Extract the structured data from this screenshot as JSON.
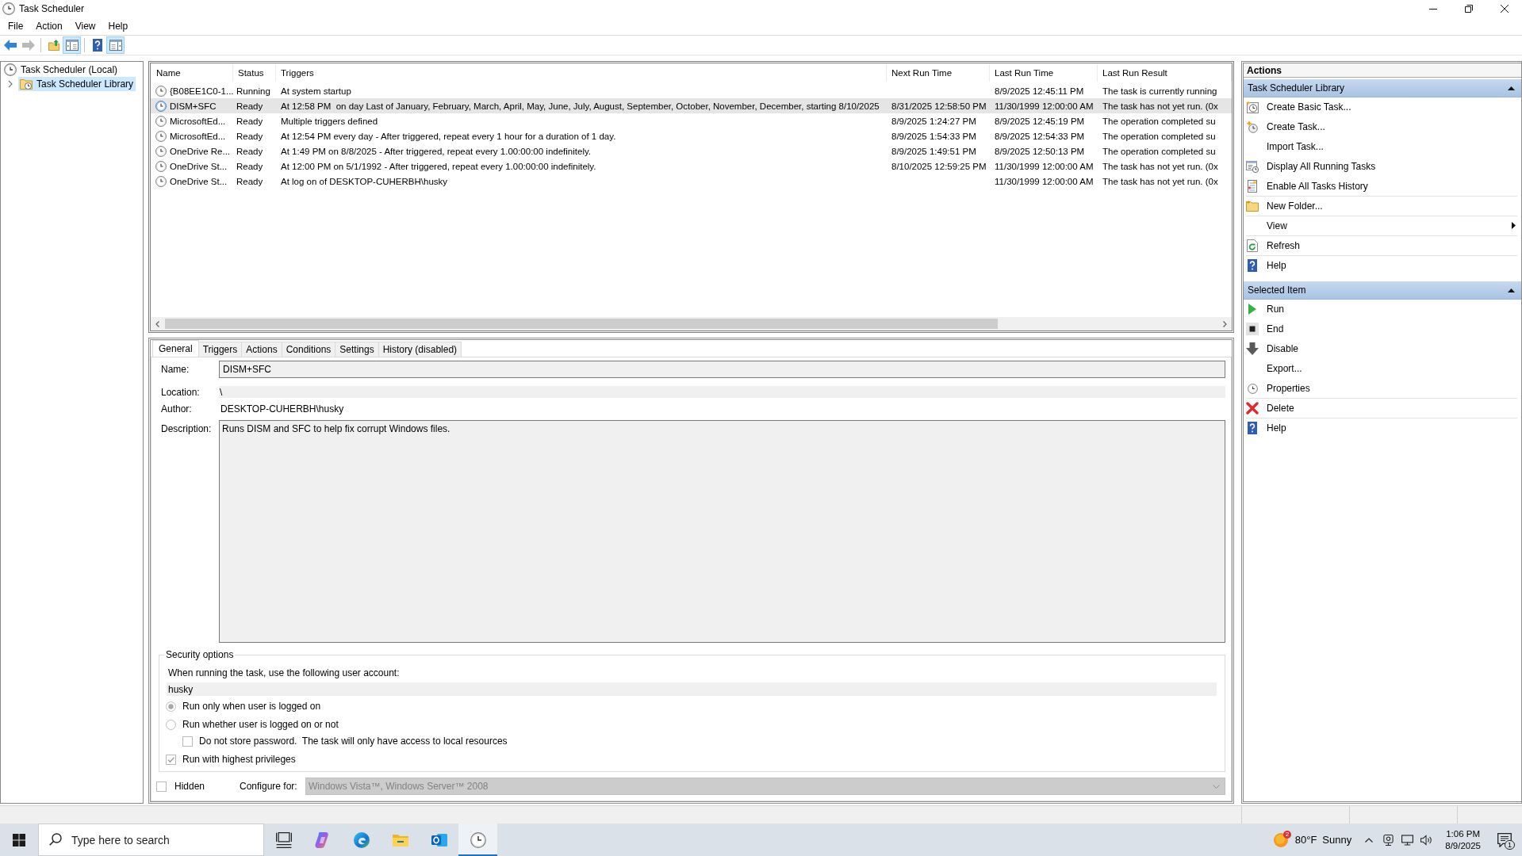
{
  "window": {
    "title": "Task Scheduler"
  },
  "menu_bar": [
    "File",
    "Action",
    "View",
    "Help"
  ],
  "toolbar": [
    [
      {
        "kind": "back",
        "disabled": false,
        "pressed": false
      },
      {
        "kind": "forward",
        "disabled": true,
        "pressed": false
      }
    ],
    [
      {
        "kind": "up",
        "disabled": false,
        "pressed": false
      },
      {
        "kind": "tree",
        "disabled": false,
        "pressed": true
      }
    ],
    [
      {
        "kind": "help",
        "disabled": false,
        "pressed": false
      },
      {
        "kind": "actions",
        "disabled": false,
        "pressed": true
      }
    ]
  ],
  "tree": [
    {
      "label": "Task Scheduler (Local)",
      "selected": false,
      "children": [
        {
          "label": "Task Scheduler Library",
          "selected": true,
          "expanded": false
        }
      ]
    }
  ],
  "task_list": {
    "columns": [
      "Name",
      "Status",
      "Triggers",
      "Next Run Time",
      "Last Run Time",
      "Last Run Result"
    ],
    "rows": [
      {
        "name": "{B08EE1C0-1...",
        "status": "Running",
        "triggers": "At system startup",
        "last_run_time": "8/9/2025 12:45:11 PM",
        "last_run_result": "The task is currently running",
        "selected": false
      },
      {
        "name": "DISM+SFC",
        "status": "Ready",
        "triggers": "At 12:58 PM  on day Last of January, February, March, April, May, June, July, August, September, October, November, December, starting 8/10/2025",
        "next_run_time": "8/31/2025 12:58:50 PM",
        "last_run_time": "11/30/1999 12:00:00 AM",
        "last_run_result": "The task has not yet run. (0x",
        "selected": true
      },
      {
        "name": "MicrosoftEd...",
        "status": "Ready",
        "triggers": "Multiple triggers defined",
        "next_run_time": "8/9/2025 1:24:27 PM",
        "last_run_time": "8/9/2025 12:45:19 PM",
        "last_run_result": "The operation completed su",
        "selected": false
      },
      {
        "name": "MicrosoftEd...",
        "status": "Ready",
        "triggers": "At 12:54 PM every day - After triggered, repeat every 1 hour for a duration of 1 day.",
        "next_run_time": "8/9/2025 1:54:33 PM",
        "last_run_time": "8/9/2025 12:54:33 PM",
        "last_run_result": "The operation completed su",
        "selected": false
      },
      {
        "name": "OneDrive Re...",
        "status": "Ready",
        "triggers": "At 1:49 PM on 8/8/2025 - After triggered, repeat every 1.00:00:00 indefinitely.",
        "next_run_time": "8/9/2025 1:49:51 PM",
        "last_run_time": "8/9/2025 12:50:13 PM",
        "last_run_result": "The operation completed su",
        "selected": false
      },
      {
        "name": "OneDrive St...",
        "status": "Ready",
        "triggers": "At 12:00 PM on 5/1/1992 - After triggered, repeat every 1.00:00:00 indefinitely.",
        "next_run_time": "8/10/2025 12:59:25 PM",
        "last_run_time": "11/30/1999 12:00:00 AM",
        "last_run_result": "The task has not yet run. (0x",
        "selected": false
      },
      {
        "name": "OneDrive St...",
        "status": "Ready",
        "triggers": "At log on of DESKTOP-CUHERBH\\husky",
        "last_run_time": "11/30/1999 12:00:00 AM",
        "last_run_result": "The task has not yet run. (0x",
        "selected": false
      }
    ]
  },
  "details": {
    "tabs": [
      {
        "label": "General",
        "selected": true
      },
      {
        "label": "Triggers",
        "selected": false
      },
      {
        "label": "Actions",
        "selected": false
      },
      {
        "label": "Conditions",
        "selected": false
      },
      {
        "label": "Settings",
        "selected": false
      },
      {
        "label": "History (disabled)",
        "selected": false
      }
    ],
    "general": {
      "name_label": "Name:",
      "name": "DISM+SFC",
      "location_label": "Location:",
      "location": "\\",
      "author_label": "Author:",
      "author": "DESKTOP-CUHERBH\\husky",
      "description_label": "Description:",
      "description": "Runs DISM and SFC to help fix corrupt Windows files."
    },
    "security": {
      "title": "Security options",
      "account_prompt": "When running the task, use the following user account:",
      "account": "husky",
      "options": [
        {
          "kind": "radio",
          "label": "Run only when user is logged on",
          "selected": true
        },
        {
          "kind": "radio",
          "label": "Run whether user is logged on or not",
          "selected": false,
          "children": [
            {
              "kind": "checkbox",
              "label": "Do not store password.  The task will only have access to local resources",
              "checked": false
            }
          ]
        },
        {
          "kind": "checkbox",
          "label": "Run with highest privileges",
          "checked": true
        }
      ]
    },
    "hidden": {
      "label": "Hidden",
      "checked": false
    },
    "configure_for": {
      "label": "Configure for:",
      "value": "Windows Vista™, Windows Server™ 2008",
      "disabled": true
    }
  },
  "actions_pane": {
    "title": "Actions",
    "sections": [
      {
        "title": "Task Scheduler Library",
        "expanded": true,
        "items": [
          {
            "label": "Create Basic Task...",
            "kind": "command",
            "divider_below": false
          },
          {
            "label": "Create Task...",
            "kind": "command",
            "divider_below": false
          },
          {
            "label": "Import Task...",
            "kind": "command",
            "divider_below": false
          },
          {
            "label": "Display All Running Tasks",
            "kind": "command",
            "divider_below": false
          },
          {
            "label": "Enable All Tasks History",
            "kind": "command",
            "divider_below": true
          },
          {
            "label": "New Folder...",
            "kind": "command",
            "divider_below": true
          },
          {
            "label": "View",
            "kind": "submenu",
            "divider_below": true
          },
          {
            "label": "Refresh",
            "kind": "command",
            "divider_below": true
          },
          {
            "label": "Help",
            "kind": "command",
            "divider_below": false
          }
        ]
      },
      {
        "title": "Selected Item",
        "expanded": true,
        "items": [
          {
            "label": "Run",
            "kind": "command",
            "divider_below": false
          },
          {
            "label": "End",
            "kind": "command",
            "divider_below": false
          },
          {
            "label": "Disable",
            "kind": "command",
            "divider_below": false
          },
          {
            "label": "Export...",
            "kind": "command",
            "divider_below": false
          },
          {
            "label": "Properties",
            "kind": "command",
            "divider_below": true
          },
          {
            "label": "Delete",
            "kind": "command",
            "divider_below": true
          },
          {
            "label": "Help",
            "kind": "command",
            "divider_below": false
          }
        ]
      }
    ]
  },
  "taskbar": {
    "search": {
      "placeholder": "Type here to search"
    },
    "apps": [
      {
        "kind": "task-view",
        "active": false
      },
      {
        "kind": "copilot",
        "active": false
      },
      {
        "kind": "edge",
        "active": false
      },
      {
        "kind": "file-explorer",
        "active": false
      },
      {
        "kind": "outlook",
        "active": false
      },
      {
        "kind": "task-scheduler",
        "active": true
      }
    ],
    "weather": {
      "badge": "2",
      "temperature": "80°F",
      "condition": "Sunny"
    },
    "clock": {
      "time": "1:06 PM",
      "date": "8/9/2025"
    },
    "notifications": {
      "badge": "1"
    }
  }
}
